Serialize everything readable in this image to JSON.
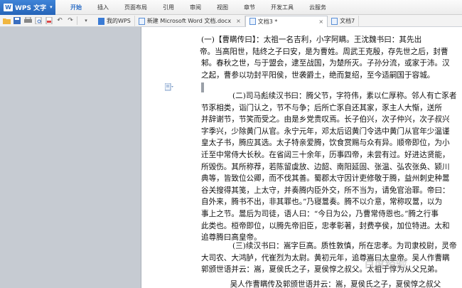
{
  "app": {
    "name": "WPS 文字",
    "logo_text": "W"
  },
  "menu": [
    {
      "label": "开始",
      "active": true
    },
    {
      "label": "插入"
    },
    {
      "label": "页面布局"
    },
    {
      "label": "引用"
    },
    {
      "label": "审阅"
    },
    {
      "label": "视图"
    },
    {
      "label": "章节"
    },
    {
      "label": "开发工具"
    },
    {
      "label": "云服务"
    }
  ],
  "toolbar_icons": [
    "open-folder-icon",
    "save-icon",
    "print-icon",
    "print-preview-icon",
    "export-pdf-icon",
    "undo-icon",
    "redo-icon",
    "dropdown-icon"
  ],
  "tabs": [
    {
      "label": "我的WPS",
      "icon": "home-icon"
    },
    {
      "label": "新建 Microsoft Word 文档.docx",
      "close": "×"
    },
    {
      "label": "文档3 *",
      "close": "×",
      "active": true
    },
    {
      "label": "文档7"
    }
  ],
  "document": {
    "para1": [
      "(一)【曹瞒传曰】：太祖一名吉利，小字阿瞒。王沈魏书曰：其先出",
      "帝。当高阳世，陆终之子曰安，是为曹姓。周武王克殷，存先世之后，封曹",
      "邾。春秋之世，与于盟会，逮至战国，为楚所灭。子孙分流，或家于沛。汉",
      "之起，曹参以功封平阳侯，世袭爵土，绝而复绍，至今适嗣国于容城。"
    ],
    "para2": [
      "(二)司马彪续汉书曰：腾父节，字符伟，素以仁厚称。邻人有亡豕者",
      "节豕相类，诣门认之，节不与争；后所亡豕自还其家，豕主人大惭，送所",
      "并辞谢节，节笑而受之。由是乡党贵叹焉。长子伯兴，次子仲兴，次子叔兴",
      "字季兴，少除黄门从官。永宁元年，邓太后诏黄门令选中黄门从官年少温谨",
      "皇太子书，腾应其选。太子特亲爱腾，饮食赏赐与众有异。顺帝即位，为小",
      "迁至中常侍大长秋。在省闼三十余年，历事四帝，未尝有过。好进达贤能，",
      "所毁伤。其所称荐，若陈留虞放、边韶、南阳延固、张温、弘农张奂、颍川",
      "典等，皆致位公卿，而不伐其善。蜀郡太守因计吏修敬于腾，益州刺史种暠",
      "谷关搜得其笺，上太守，并奏腾内臣外交，所不当为，请免官治罪。帝曰：",
      "自外来，腾书不出，非其罪也。”乃寝暠奏。腾不以介意，常称叹暠，以为",
      "事上之节。暠后为司徒，语人曰：“今日为公，乃曹常侍恩也。”腾之行事",
      "此类也。桓帝即位，以腾先帝旧臣，忠孝彰著，封费亭侯，加位特进。太和",
      "追尊腾曰高皇帝。"
    ],
    "para3": [
      "(三)续汉书曰：嵩字巨高。质性敦慎，所在忠孝。为司隶校尉，灵帝",
      "大司农、大鸿胪，代崔烈为太尉。黄初元年，追尊嵩曰太皇帝。吴人作曹瞒",
      "郭颁世语并云：嵩，夏侯氏之子，夏侯惇之叔父。太祖于惇为从父兄弟。"
    ],
    "para4": [
      "　吴人作曹瞒传及郭颁世语并云：嵩，夏侯氏之子，夏侯惇之叔父"
    ]
  },
  "watermark": "百度经验"
}
